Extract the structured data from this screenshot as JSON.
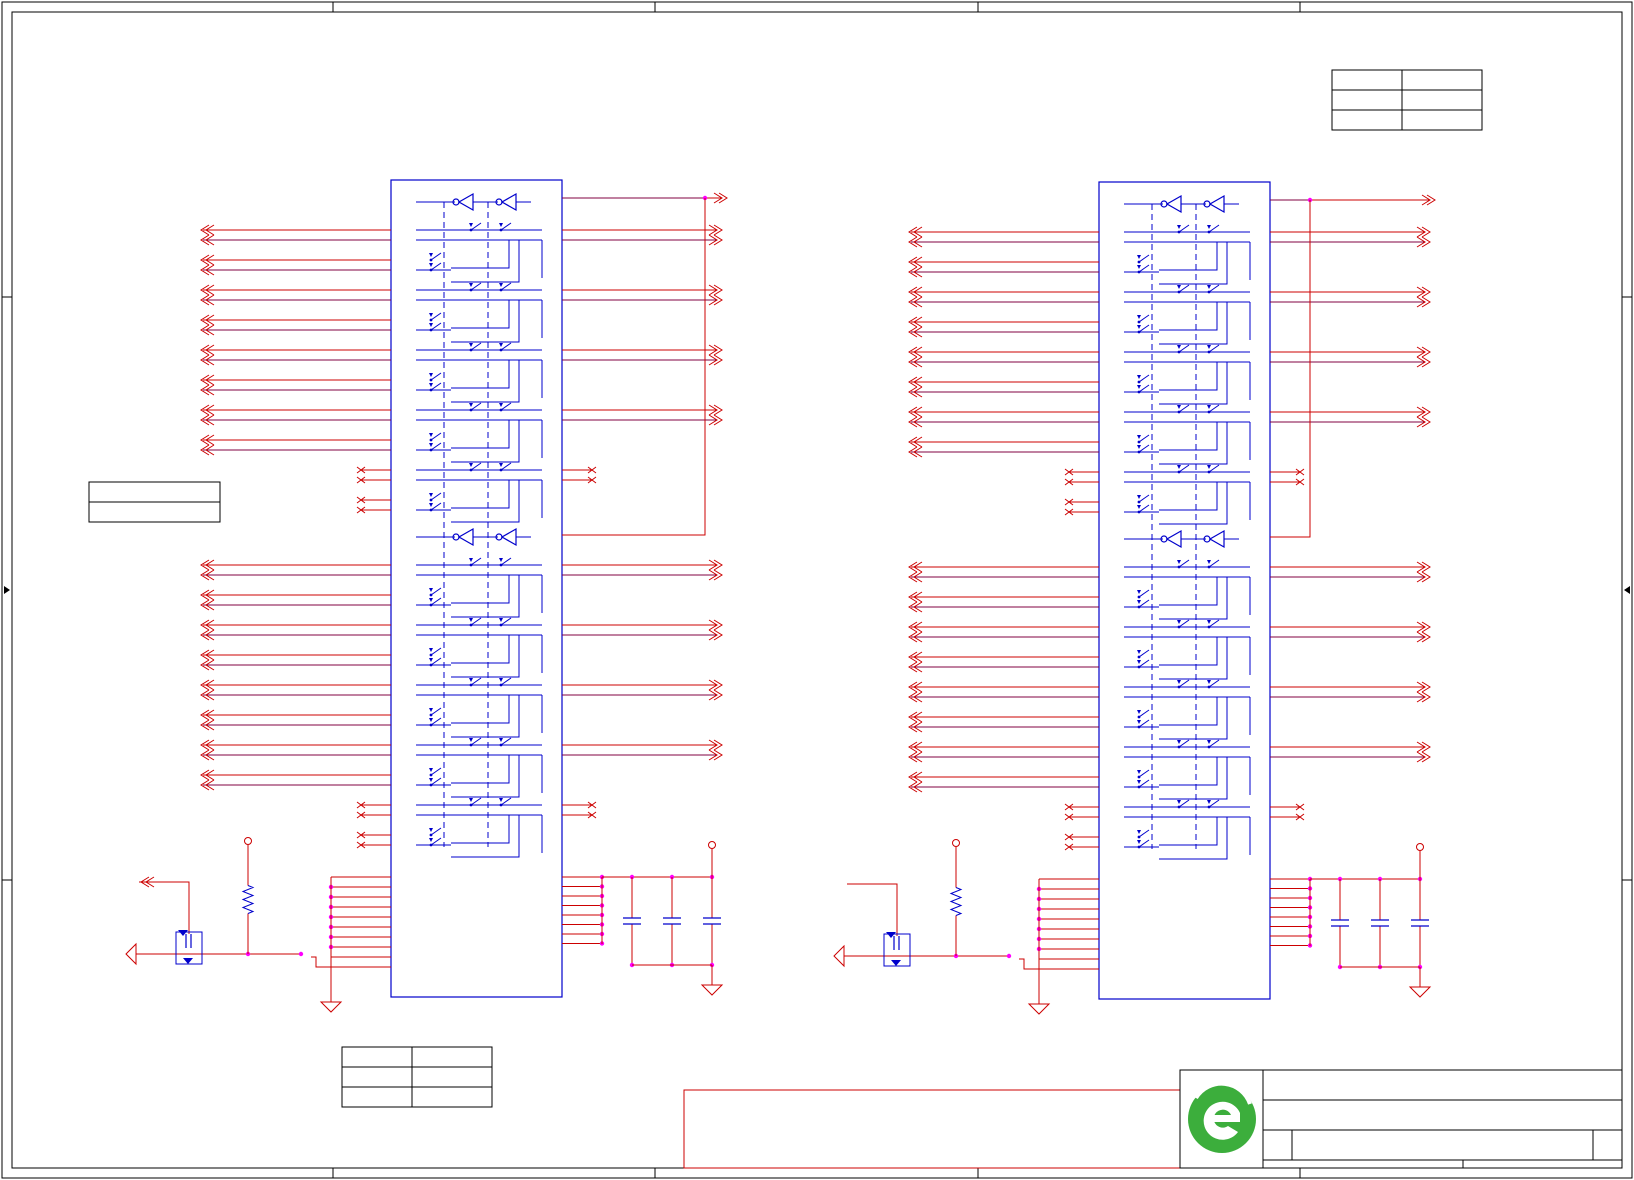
{
  "colors": {
    "border": "#000000",
    "wire": "#cc0000",
    "bus": "#800040",
    "chip": "#0000cc",
    "junction": "#ff00ff",
    "logo": "#3cae3c"
  },
  "icons": {
    "logo": "company-logo-icon",
    "net_port": "net-port-icon",
    "ground": "ground-symbol-icon",
    "power": "power-pin-icon",
    "resistor": "resistor-icon",
    "capacitor": "capacitor-icon",
    "mosfet": "mosfet-icon",
    "switch": "analog-switch-icon",
    "buffer": "buffer-gate-icon"
  },
  "diagram": {
    "chips": 2,
    "switch_pairs_per_chip": 10,
    "buffers_per_chip": 4,
    "capacitors_per_chip": 3
  }
}
